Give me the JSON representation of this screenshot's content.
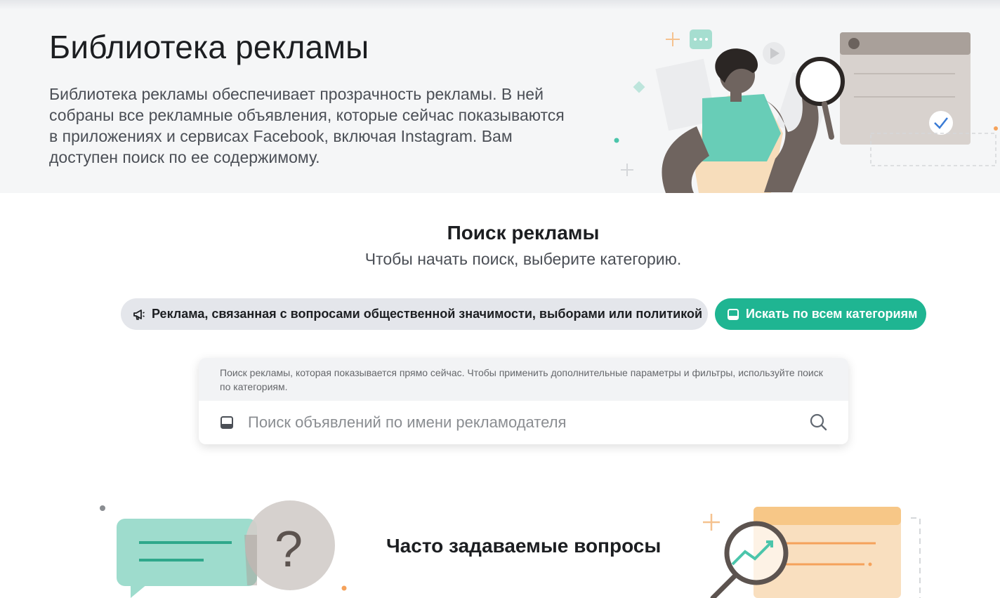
{
  "hero": {
    "title": "Библиотека рекламы",
    "description": "Библиотека рекламы обеспечивает прозрачность рекламы. В ней собраны все рекламные объявления, которые сейчас показываются в приложениях и сервисах Facebook, включая Instagram. Вам доступен поиск по ее содержимому."
  },
  "search": {
    "title": "Поиск рекламы",
    "subtitle": "Чтобы начать поиск, выберите категорию."
  },
  "categories": {
    "issues_label": "Реклама, связанная с вопросами общественной значимости, выборами или политикой",
    "all_label": "Искать по всем категориям"
  },
  "search_card": {
    "hint": "Поиск рекламы, которая показывается прямо сейчас. Чтобы применить дополнительные параметры и фильтры, используйте поиск по категориям.",
    "placeholder": "Поиск объявлений по имени рекламодателя",
    "value": ""
  },
  "faq": {
    "title": "Часто задаваемые вопросы"
  },
  "colors": {
    "accent": "#1fb592",
    "chip_gray": "#e4e6eb",
    "hero_bg": "#f5f6f7"
  }
}
